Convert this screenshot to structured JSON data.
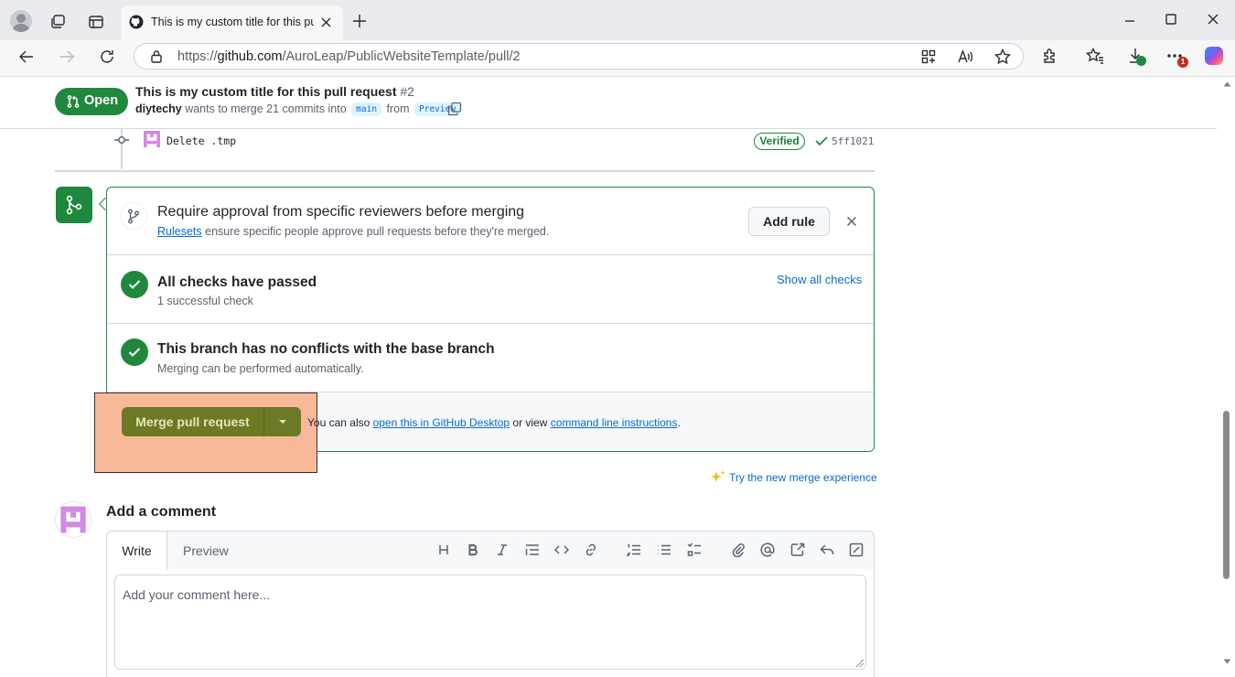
{
  "browser": {
    "tab_title": "This is my custom title for this pull request",
    "url_prefix": "https://",
    "url_host": "github.com",
    "url_path": "/AuroLeap/PublicWebsiteTemplate/pull/2",
    "download_badge": "1"
  },
  "pr": {
    "state": "Open",
    "title": "This is my custom title for this pull request",
    "number": "#2",
    "author": "diytechy",
    "merge_text_1": "wants to merge 21 commits into",
    "base": "main",
    "from": "from",
    "head": "Preview"
  },
  "commit": {
    "message": "Delete .tmp",
    "verified": "Verified",
    "sha": "5ff1021"
  },
  "merge_box": {
    "rule": {
      "title": "Require approval from specific reviewers before merging",
      "link": "Rulesets",
      "desc": "ensure specific people approve pull requests before they're merged.",
      "button": "Add rule"
    },
    "checks": {
      "title": "All checks have passed",
      "desc": "1 successful check",
      "link": "Show all checks"
    },
    "conflicts": {
      "title": "This branch has no conflicts with the base branch",
      "desc": "Merging can be performed automatically."
    },
    "merge_button": "Merge pull request",
    "also_text": "You can also",
    "desktop_link": "open this in GitHub Desktop",
    "or_view": "or view",
    "cli_link": "command line instructions",
    "period": ".",
    "new_experience": "Try the new merge experience"
  },
  "comment": {
    "heading": "Add a comment",
    "tab_write": "Write",
    "tab_preview": "Preview",
    "placeholder": "Add your comment here..."
  },
  "colors": {
    "green": "#1f883d",
    "merge_button": "#6d7a25",
    "highlight": "#f8b999",
    "link": "#0969da"
  }
}
